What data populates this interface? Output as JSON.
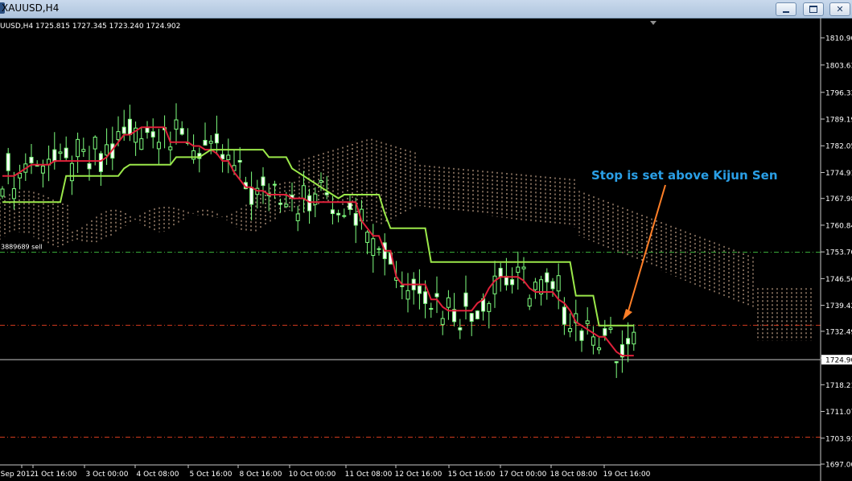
{
  "window": {
    "title": "XAUUSD,H4",
    "minimize_icon": "minimize-icon",
    "restore_icon": "restore-icon",
    "close_icon": "close-icon"
  },
  "info_line": "UUSD,H4  1725.815 1727.345 1723.240 1724.902",
  "order_label": "3889689 sell",
  "current_price": "1724.90",
  "annotation": {
    "text": "Stop is set above Kijun Sen",
    "color": "#2a9fe6",
    "arrow_color": "#ff7f27"
  },
  "colors": {
    "bull": "#7fff7f",
    "bear": "#ffffff",
    "tenkan": "#e0203a",
    "kijun": "#9be84a",
    "cloud": "#f0c8a8",
    "order_line": "#3cb43c",
    "sl_line": "#d23a1e"
  },
  "chart_data": {
    "type": "candlestick",
    "symbol": "XAUUSD",
    "timeframe": "H4",
    "ylim": [
      1697.0,
      1814.0
    ],
    "y_ticks": [
      "1810.90",
      "1803.63",
      "1796.33",
      "1789.19",
      "1782.05",
      "1774.91",
      "1767.98",
      "1760.84",
      "1753.70",
      "1746.56",
      "1739.42",
      "1732.49",
      "1725.35",
      "1718.21",
      "1711.07",
      "1703.93",
      "1697.00"
    ],
    "x_ticks": [
      "Sep 2012",
      "1 Oct 16:00",
      "3 Oct 00:00",
      "4 Oct 08:00",
      "5 Oct 16:00",
      "8 Oct 16:00",
      "10 Oct 00:00",
      "11 Oct 08:00",
      "12 Oct 16:00",
      "15 Oct 16:00",
      "17 Oct 00:00",
      "18 Oct 08:00",
      "19 Oct 16:00"
    ],
    "horizontal_lines": [
      {
        "name": "order",
        "price": 1753.6,
        "style": "dash-dot"
      },
      {
        "name": "stop-loss",
        "price": 1734.1,
        "style": "dash-dot"
      },
      {
        "name": "lower-level",
        "price": 1704.2,
        "style": "dash-dot"
      },
      {
        "name": "bid",
        "price": 1724.9,
        "style": "solid"
      }
    ],
    "series": [
      {
        "name": "Tenkan Sen",
        "type": "line",
        "values": [
          1774,
          1774,
          1774,
          1775,
          1776,
          1777,
          1777,
          1777,
          1777,
          1778,
          1778,
          1778,
          1778,
          1778,
          1778,
          1778,
          1778,
          1778,
          1779,
          1781,
          1783,
          1785,
          1785,
          1786,
          1787,
          1787,
          1787,
          1787,
          1787,
          1783,
          1783,
          1783,
          1783,
          1782,
          1782,
          1781,
          1781,
          1780,
          1778,
          1778,
          1775,
          1773,
          1771,
          1771,
          1770,
          1770,
          1769,
          1769,
          1769,
          1769,
          1768,
          1768,
          1768,
          1767,
          1767,
          1767,
          1767,
          1767,
          1767,
          1767,
          1767,
          1767,
          1762,
          1760,
          1758,
          1758,
          1754,
          1754,
          1747,
          1745,
          1745,
          1745,
          1745,
          1745,
          1741,
          1741,
          1739,
          1738,
          1738,
          1738,
          1738,
          1738,
          1740,
          1741,
          1744,
          1746,
          1747,
          1747,
          1747,
          1747,
          1746,
          1744,
          1743,
          1743,
          1743,
          1743,
          1741,
          1740,
          1738,
          1735,
          1734,
          1733,
          1732,
          1731,
          1731,
          1729,
          1727,
          1726,
          1726,
          1726
        ]
      },
      {
        "name": "Kijun Sen",
        "type": "line",
        "values": [
          1767,
          1767,
          1767,
          1767,
          1767,
          1767,
          1767,
          1767,
          1767,
          1767,
          1767,
          1774,
          1774,
          1774,
          1774,
          1774,
          1774,
          1774,
          1774,
          1774,
          1774,
          1776,
          1777,
          1777,
          1777,
          1777,
          1777,
          1777,
          1777,
          1777,
          1779,
          1779,
          1779,
          1779,
          1779,
          1780,
          1781,
          1781,
          1781,
          1781,
          1781,
          1781,
          1781,
          1781,
          1781,
          1781,
          1779,
          1779,
          1779,
          1779,
          1776,
          1775,
          1774,
          1773,
          1772,
          1771,
          1770,
          1769,
          1768,
          1769,
          1769,
          1769,
          1769,
          1769,
          1769,
          1769,
          1764,
          1760,
          1760,
          1760,
          1760,
          1760,
          1760,
          1760,
          1751,
          1751,
          1751,
          1751,
          1751,
          1751,
          1751,
          1751,
          1751,
          1751,
          1751,
          1751,
          1751,
          1751,
          1751,
          1751,
          1751,
          1751,
          1751,
          1751,
          1751,
          1751,
          1751,
          1751,
          1751,
          1742,
          1742,
          1742,
          1742,
          1734,
          1734,
          1734,
          1734,
          1734,
          1734,
          1734
        ]
      }
    ],
    "ichimoku_cloud": {
      "name": "Kumo",
      "style": "dotted-vertical-lines"
    },
    "candles_ohlc_range": {
      "start": "Sep 2012",
      "end": "19 Oct 16:00",
      "last_close": 1724.902,
      "last_high": 1727.345,
      "last_low": 1723.24,
      "last_open": 1725.815
    }
  }
}
